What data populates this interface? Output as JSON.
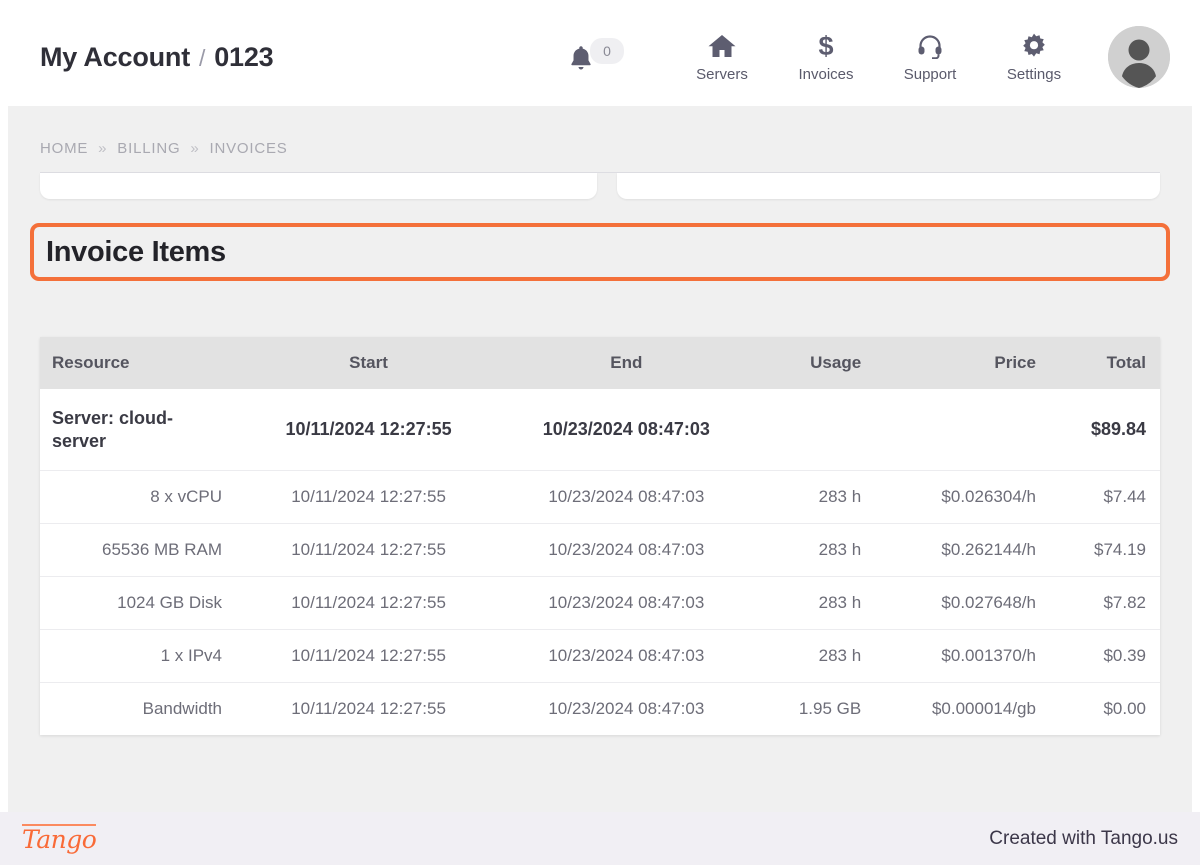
{
  "header": {
    "account_label": "My Account",
    "separator": "/",
    "account_id": "0123",
    "notifications": {
      "icon": "bell-icon",
      "count": "0"
    },
    "nav": [
      {
        "icon": "home-icon",
        "label": "Servers"
      },
      {
        "icon": "dollar-icon",
        "label": "Invoices"
      },
      {
        "icon": "headset-icon",
        "label": "Support"
      },
      {
        "icon": "gear-icon",
        "label": "Settings"
      }
    ],
    "avatar": "user-avatar"
  },
  "breadcrumb": {
    "items": [
      "HOME",
      "BILLING",
      "INVOICES"
    ],
    "chevron": "»"
  },
  "highlight": {
    "heading": "Invoice Items",
    "border_color": "#f4703a"
  },
  "table": {
    "columns": [
      "Resource",
      "Start",
      "End",
      "Usage",
      "Price",
      "Total"
    ],
    "rows": [
      {
        "kind": "main",
        "resource": "Server: cloud-server",
        "start": "10/11/2024 12:27:55",
        "end": "10/23/2024 08:47:03",
        "usage": "",
        "price": "",
        "total": "$89.84"
      },
      {
        "kind": "sub",
        "resource": "8 x vCPU",
        "start": "10/11/2024 12:27:55",
        "end": "10/23/2024 08:47:03",
        "usage": "283 h",
        "price": "$0.026304/h",
        "total": "$7.44"
      },
      {
        "kind": "sub",
        "resource": "65536 MB RAM",
        "start": "10/11/2024 12:27:55",
        "end": "10/23/2024 08:47:03",
        "usage": "283 h",
        "price": "$0.262144/h",
        "total": "$74.19"
      },
      {
        "kind": "sub",
        "resource": "1024 GB Disk",
        "start": "10/11/2024 12:27:55",
        "end": "10/23/2024 08:47:03",
        "usage": "283 h",
        "price": "$0.027648/h",
        "total": "$7.82"
      },
      {
        "kind": "sub",
        "resource": "1 x IPv4",
        "start": "10/11/2024 12:27:55",
        "end": "10/23/2024 08:47:03",
        "usage": "283 h",
        "price": "$0.001370/h",
        "total": "$0.39"
      },
      {
        "kind": "sub",
        "resource": "Bandwidth",
        "start": "10/11/2024 12:27:55",
        "end": "10/23/2024 08:47:03",
        "usage": "1.95 GB",
        "price": "$0.000014/gb",
        "total": "$0.00"
      }
    ]
  },
  "footer": {
    "logo_text": "Tango",
    "note": "Created with Tango.us"
  },
  "colors": {
    "accent_orange": "#f4703a",
    "page_background": "#f0f0f0",
    "header_background": "#ffffff",
    "table_header": "#e2e2e2",
    "footer_background": "#f1eff4",
    "tango_orange": "#f96a37"
  }
}
